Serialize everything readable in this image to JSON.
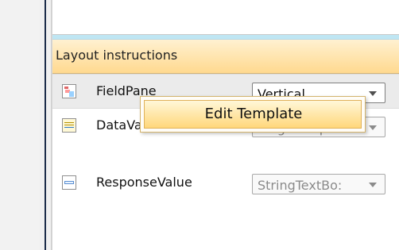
{
  "layout_instructions": {
    "header": "Layout instructions",
    "items": [
      {
        "label": "FieldPane",
        "dropdown_value": "Vertical",
        "icon": "field-pane-icon"
      },
      {
        "label": "DataValue",
        "dropdown_value": "SingleRespor",
        "icon": "data-value-icon"
      },
      {
        "label": "ResponseValue",
        "dropdown_value": "StringTextBo:",
        "icon": "response-value-icon"
      }
    ]
  },
  "context_menu": {
    "items": [
      {
        "label": "Edit Template"
      }
    ]
  },
  "colors": {
    "header_background": "#ffd98f",
    "accent_blue": "#bfe6f3",
    "context_menu_highlight": "#ffd77b"
  }
}
